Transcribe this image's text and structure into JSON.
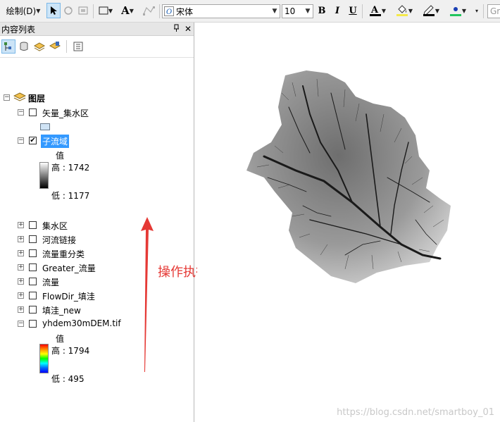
{
  "toolbar": {
    "draw_label": "绘制(D)",
    "font_name": "宋体",
    "font_size": "10",
    "bold": "B",
    "italic": "I",
    "underline": "U",
    "text_a": "A",
    "overflow_text": "Gr"
  },
  "panel": {
    "title": "内容列表",
    "pin": "ᵖ",
    "close": "✕"
  },
  "tree": {
    "root_label": "图层",
    "layers": [
      {
        "name": "矢量_集水区",
        "checked": false,
        "expanded": true
      },
      {
        "name": "子流域",
        "checked": true,
        "expanded": true,
        "selected": true
      },
      {
        "name": "集水区",
        "checked": false,
        "expanded": false
      },
      {
        "name": "河流链接",
        "checked": false,
        "expanded": false
      },
      {
        "name": "流量重分类",
        "checked": false,
        "expanded": false
      },
      {
        "name": "Greater_流量",
        "checked": false,
        "expanded": false
      },
      {
        "name": "流量",
        "checked": false,
        "expanded": false
      },
      {
        "name": "FlowDir_填洼",
        "checked": false,
        "expanded": false
      },
      {
        "name": "填洼_new",
        "checked": false,
        "expanded": false
      },
      {
        "name": "yhdem30mDEM.tif",
        "checked": false,
        "expanded": true
      }
    ],
    "subbasin_legend": {
      "value_label": "值",
      "high": "高 : 1742",
      "low": "低 : 1177"
    },
    "dem_legend": {
      "value_label": "值",
      "high": "高 : 1794",
      "low": "低 : 495"
    }
  },
  "annotation": {
    "text": "操作执行顺序",
    "color": "#e53935"
  },
  "watermark": "https://blog.csdn.net/smartboy_01",
  "colors": {
    "selection": "#3399ff",
    "toolbar_bg": "#f0f0f0",
    "arrow": "#e53935"
  }
}
